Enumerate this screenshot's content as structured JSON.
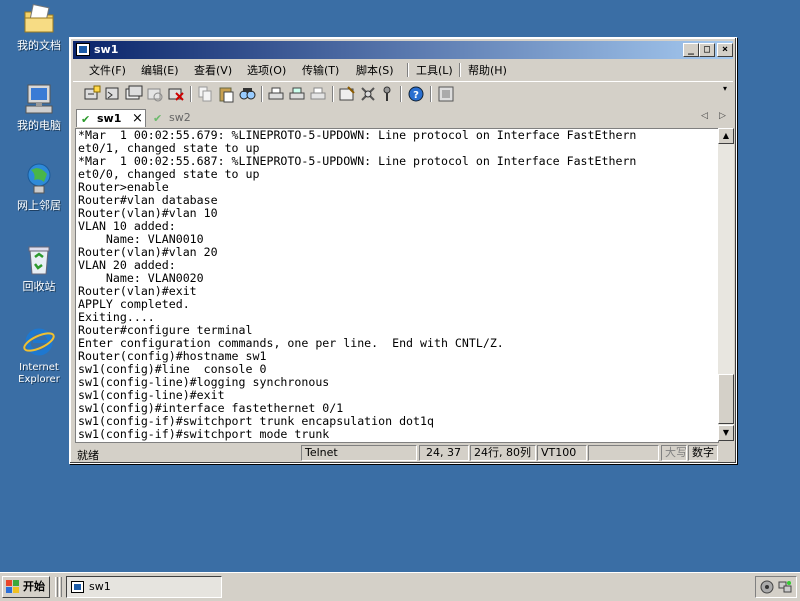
{
  "desktop": {
    "icons": [
      {
        "label": "我的文档",
        "icon": "my-documents-icon"
      },
      {
        "label": "我的电脑",
        "icon": "my-computer-icon"
      },
      {
        "label": "网上邻居",
        "icon": "network-places-icon"
      },
      {
        "label": "回收站",
        "icon": "recycle-bin-icon"
      },
      {
        "label": "Internet Explorer",
        "icon": "internet-explorer-icon"
      }
    ]
  },
  "window": {
    "title": "sw1",
    "menu": [
      "文件(F)",
      "编辑(E)",
      "查看(V)",
      "选项(O)",
      "传输(T)",
      "脚本(S)",
      "工具(L)",
      "帮助(H)"
    ],
    "tabs": [
      {
        "label": "sw1",
        "active": true
      },
      {
        "label": "sw2",
        "active": false
      }
    ],
    "tab_close": "×",
    "terminal_lines": [
      "*Mar  1 00:02:55.679: %LINEPROTO-5-UPDOWN: Line protocol on Interface FastEthern",
      "et0/1, changed state to up",
      "*Mar  1 00:02:55.687: %LINEPROTO-5-UPDOWN: Line protocol on Interface FastEthern",
      "et0/0, changed state to up",
      "Router>enable",
      "Router#vlan database",
      "Router(vlan)#vlan 10",
      "VLAN 10 added:",
      "    Name: VLAN0010",
      "Router(vlan)#vlan 20",
      "VLAN 20 added:",
      "    Name: VLAN0020",
      "Router(vlan)#exit",
      "APPLY completed.",
      "Exiting....",
      "Router#configure terminal",
      "Enter configuration commands, one per line.  End with CNTL/Z.",
      "Router(config)#hostname sw1",
      "sw1(config)#line  console 0",
      "sw1(config-line)#logging synchronous",
      "sw1(config-line)#exit",
      "sw1(config)#interface fastethernet 0/1",
      "sw1(config-if)#switchport trunk encapsulation dot1q",
      "sw1(config-if)#switchport mode trunk"
    ],
    "status": {
      "ready": "就绪",
      "protocol": "Telnet",
      "cursor": "24, 37",
      "size": "24行, 80列",
      "emulation": "VT100",
      "caps": "大写",
      "num": "数字"
    }
  },
  "taskbar": {
    "start_label": "开始",
    "task_item": "sw1"
  },
  "colors": {
    "desktop": "#3a6ea5",
    "title_start": "#0a246a",
    "title_end": "#a6caf0",
    "face": "#d4d0c8"
  }
}
